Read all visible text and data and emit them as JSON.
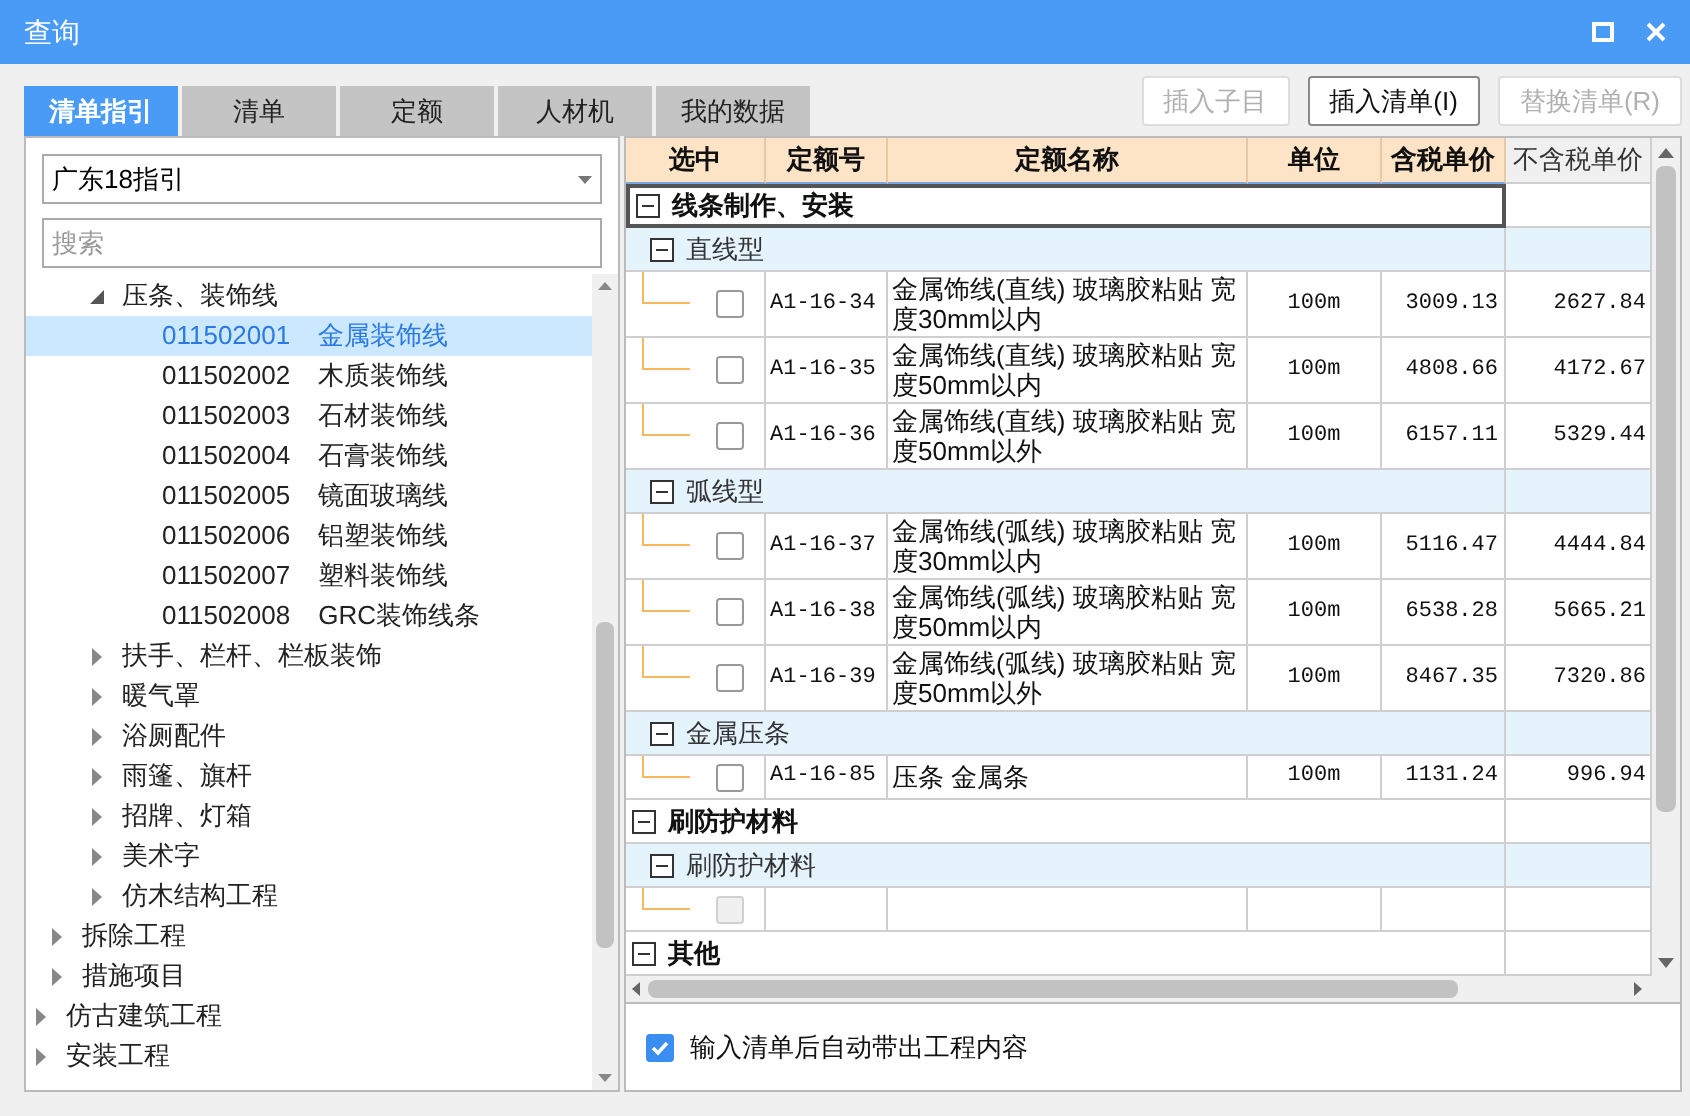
{
  "window": {
    "title": "查询"
  },
  "tabs": [
    {
      "label": "清单指引",
      "selected": true
    },
    {
      "label": "清单",
      "selected": false
    },
    {
      "label": "定额",
      "selected": false
    },
    {
      "label": "人材机",
      "selected": false
    },
    {
      "label": "我的数据",
      "selected": false
    }
  ],
  "buttons": [
    {
      "label": "插入子目",
      "disabled": true
    },
    {
      "label": "插入清单(I)",
      "disabled": false
    },
    {
      "label": "替换清单(R)",
      "disabled": true
    }
  ],
  "guide_select": {
    "value": "广东18指引"
  },
  "search": {
    "placeholder": "搜索"
  },
  "tree": {
    "items": [
      {
        "children": [
          {
            "children": [
              {
                "label": "压条、装饰线",
                "expanded": true,
                "selected": false,
                "children": [
                  {
                    "code": "011502001",
                    "label": "金属装饰线",
                    "selected": true
                  },
                  {
                    "code": "011502002",
                    "label": "木质装饰线",
                    "selected": false
                  },
                  {
                    "code": "011502003",
                    "label": "石材装饰线",
                    "selected": false
                  },
                  {
                    "code": "011502004",
                    "label": "石膏装饰线",
                    "selected": false
                  },
                  {
                    "code": "011502005",
                    "label": "镜面玻璃线",
                    "selected": false
                  },
                  {
                    "code": "011502006",
                    "label": "铝塑装饰线",
                    "selected": false
                  },
                  {
                    "code": "011502007",
                    "label": "塑料装饰线",
                    "selected": false
                  },
                  {
                    "code": "011502008",
                    "label": "GRC装饰线条",
                    "selected": false
                  }
                ]
              },
              {
                "label": "扶手、栏杆、栏板装饰",
                "expanded": false,
                "selected": false
              },
              {
                "label": "暖气罩",
                "expanded": false,
                "selected": false
              },
              {
                "label": "浴厕配件",
                "expanded": false,
                "selected": false
              },
              {
                "label": "雨篷、旗杆",
                "expanded": false,
                "selected": false
              },
              {
                "label": "招牌、灯箱",
                "expanded": false,
                "selected": false
              },
              {
                "label": "美术字",
                "expanded": false,
                "selected": false
              },
              {
                "label": "仿木结构工程",
                "expanded": false,
                "selected": false
              }
            ]
          },
          {
            "label": "拆除工程",
            "expanded": false,
            "selected": false
          },
          {
            "label": "措施项目",
            "expanded": false,
            "selected": false
          }
        ]
      },
      {
        "label": "仿古建筑工程",
        "expanded": false,
        "selected": false
      },
      {
        "label": "安装工程",
        "expanded": false,
        "selected": false
      }
    ]
  },
  "table": {
    "columns": [
      "选中",
      "定额号",
      "定额名称",
      "单位",
      "含税单价",
      "不含税单价"
    ],
    "rows": [
      {
        "kind": "group",
        "label": "线条制作、安装",
        "selected": true
      },
      {
        "kind": "subgroup",
        "label": "直线型",
        "selected": false
      },
      {
        "kind": "item",
        "checked": false,
        "disabled": false,
        "code": "A1-16-34",
        "name": "金属饰线(直线) 玻璃胶粘贴 宽度30mm以内",
        "unit": "100m",
        "price_tax": "3009.13",
        "price_notax": "2627.84"
      },
      {
        "kind": "item",
        "checked": false,
        "disabled": false,
        "code": "A1-16-35",
        "name": "金属饰线(直线) 玻璃胶粘贴 宽度50mm以内",
        "unit": "100m",
        "price_tax": "4808.66",
        "price_notax": "4172.67"
      },
      {
        "kind": "item",
        "checked": false,
        "disabled": false,
        "code": "A1-16-36",
        "name": "金属饰线(直线) 玻璃胶粘贴 宽度50mm以外",
        "unit": "100m",
        "price_tax": "6157.11",
        "price_notax": "5329.44"
      },
      {
        "kind": "subgroup",
        "label": "弧线型",
        "selected": false
      },
      {
        "kind": "item",
        "checked": false,
        "disabled": false,
        "code": "A1-16-37",
        "name": "金属饰线(弧线) 玻璃胶粘贴 宽度30mm以内",
        "unit": "100m",
        "price_tax": "5116.47",
        "price_notax": "4444.84"
      },
      {
        "kind": "item",
        "checked": false,
        "disabled": false,
        "code": "A1-16-38",
        "name": "金属饰线(弧线) 玻璃胶粘贴 宽度50mm以内",
        "unit": "100m",
        "price_tax": "6538.28",
        "price_notax": "5665.21"
      },
      {
        "kind": "item",
        "checked": false,
        "disabled": false,
        "code": "A1-16-39",
        "name": "金属饰线(弧线) 玻璃胶粘贴 宽度50mm以外",
        "unit": "100m",
        "price_tax": "8467.35",
        "price_notax": "7320.86"
      },
      {
        "kind": "subgroup",
        "label": "金属压条",
        "selected": false
      },
      {
        "kind": "item",
        "checked": false,
        "disabled": false,
        "code": "A1-16-85",
        "name": "压条 金属条",
        "unit": "100m",
        "price_tax": "1131.24",
        "price_notax": "996.94"
      },
      {
        "kind": "group",
        "label": "刷防护材料",
        "selected": false
      },
      {
        "kind": "subgroup",
        "label": "刷防护材料",
        "selected": false
      },
      {
        "kind": "item",
        "checked": false,
        "disabled": true
      },
      {
        "kind": "group",
        "label": "其他",
        "selected": false
      }
    ]
  },
  "auto_option": {
    "label": "输入清单后自动带出工程内容",
    "checked": true
  }
}
